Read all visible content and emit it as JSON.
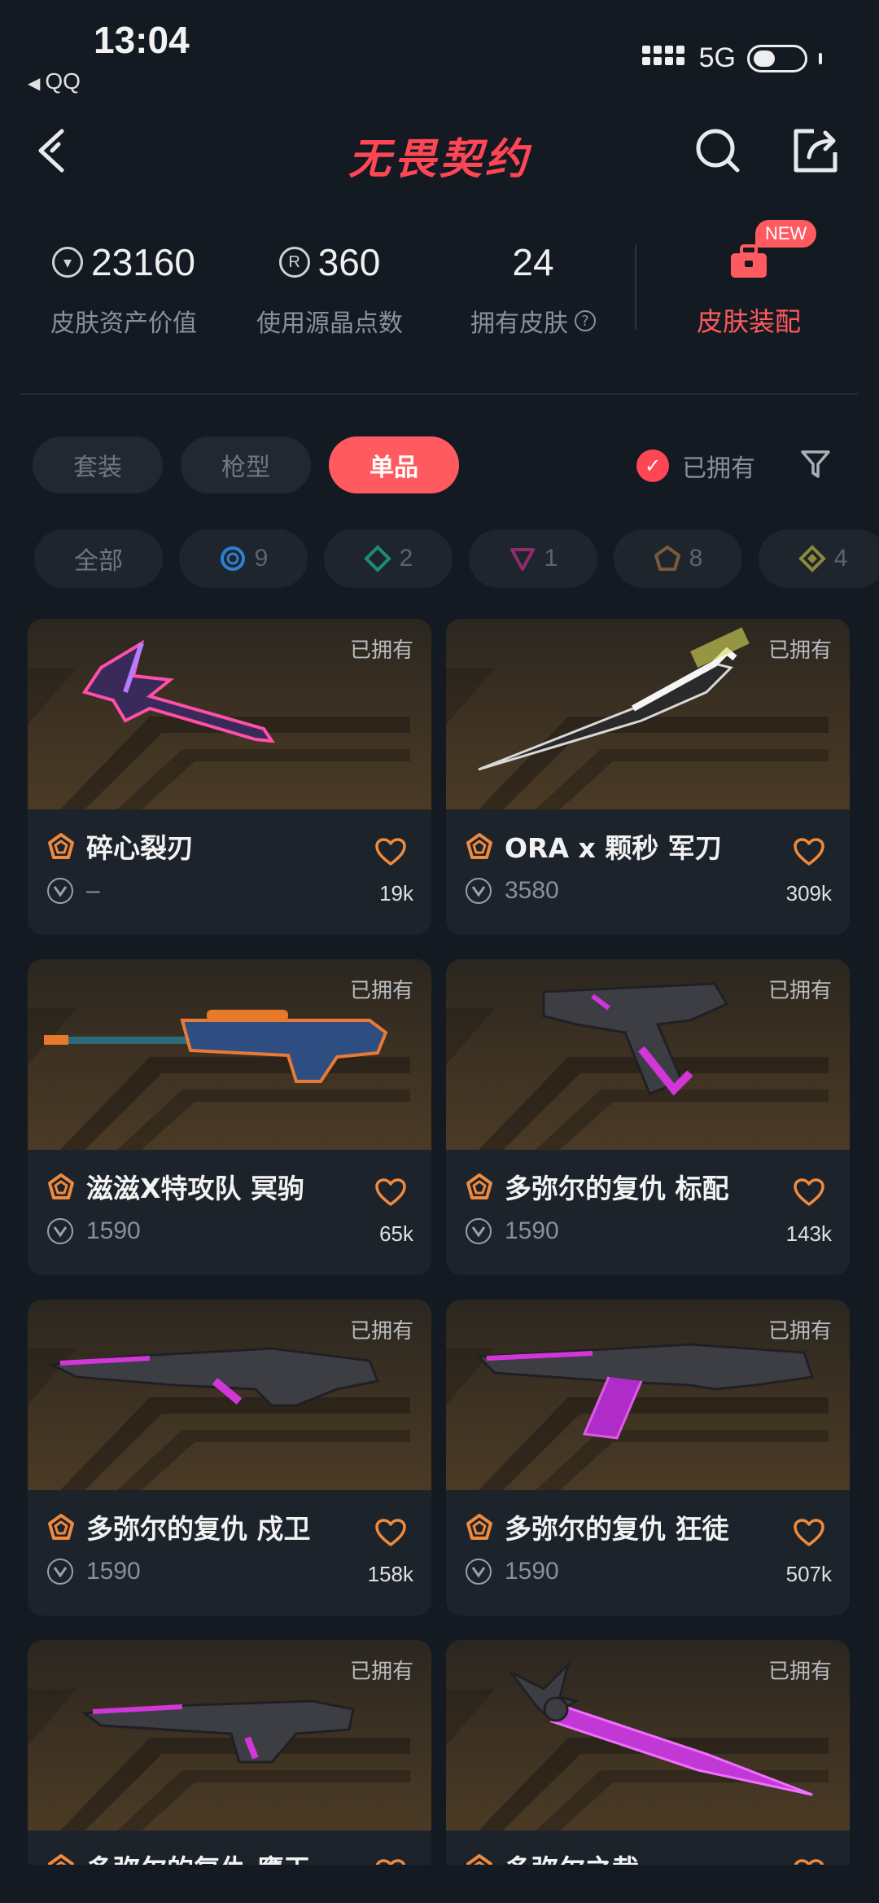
{
  "status_bar": {
    "time": "13:04",
    "back_app": "QQ",
    "network": "5G"
  },
  "header": {
    "title": "无畏契约",
    "back_icon": "chevron-left-icon",
    "search_icon": "search-icon",
    "share_icon": "share-icon"
  },
  "stats": {
    "asset_value": "23160",
    "asset_label": "皮肤资产价值",
    "radianite": "360",
    "radianite_label": "使用源晶点数",
    "owned_count": "24",
    "owned_label": "拥有皮肤",
    "outfit_badge": "NEW",
    "outfit_label": "皮肤装配"
  },
  "tabs": [
    {
      "label": "套装",
      "active": false
    },
    {
      "label": "枪型",
      "active": false
    },
    {
      "label": "单品",
      "active": true
    }
  ],
  "owned_filter": {
    "label": "已拥有",
    "checked": true
  },
  "tiers": [
    {
      "label": "全部"
    },
    {
      "count": "9",
      "color": "#2f7fd1"
    },
    {
      "count": "2",
      "color": "#1e8a78"
    },
    {
      "count": "1",
      "color": "#8e2c6d"
    },
    {
      "count": "8",
      "color": "#7a5a3a"
    },
    {
      "count": "4",
      "color": "#8a8a3a"
    }
  ],
  "owned_tag": "已拥有",
  "skins": [
    {
      "name": "碎心裂刃",
      "price": "–",
      "likes": "19k",
      "tier_color": "#f08a3c"
    },
    {
      "name": "ORA x 颗秒 军刀",
      "price": "3580",
      "likes": "309k",
      "tier_color": "#f08a3c"
    },
    {
      "name": "滋滋X特攻队 冥驹",
      "price": "1590",
      "likes": "65k",
      "tier_color": "#f08a3c"
    },
    {
      "name": "多弥尔的复仇 标配",
      "price": "1590",
      "likes": "143k",
      "tier_color": "#f08a3c"
    },
    {
      "name": "多弥尔的复仇 戍卫",
      "price": "1590",
      "likes": "158k",
      "tier_color": "#f08a3c"
    },
    {
      "name": "多弥尔的复仇 狂徒",
      "price": "1590",
      "likes": "507k",
      "tier_color": "#f08a3c"
    },
    {
      "name": "多弥尔的复仇 鹰王",
      "price": "",
      "likes": "",
      "tier_color": "#f08a3c"
    },
    {
      "name": "多弥尔之裁",
      "price": "",
      "likes": "",
      "tier_color": "#f08a3c"
    }
  ],
  "colors": {
    "accent": "#ff5a5f",
    "background": "#141a21",
    "card": "#1c232b",
    "like": "#f08a3c"
  }
}
